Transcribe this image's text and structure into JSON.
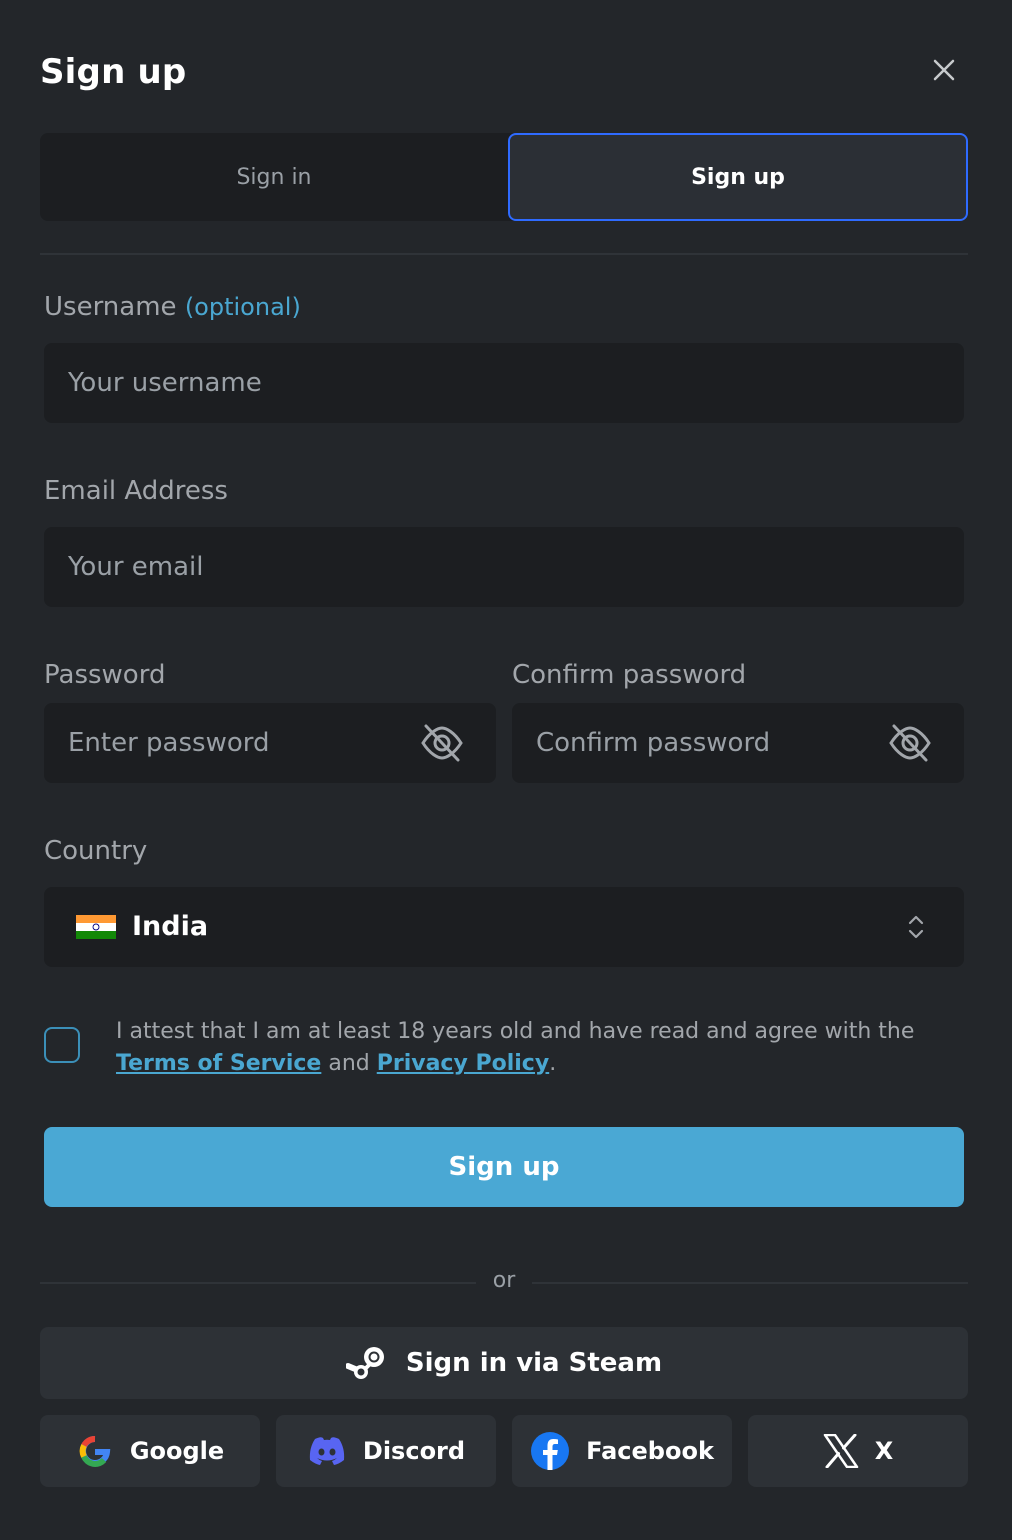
{
  "header": {
    "title": "Sign up"
  },
  "tabs": [
    {
      "label": "Sign in"
    },
    {
      "label": "Sign up"
    }
  ],
  "form": {
    "username": {
      "label": "Username",
      "optional": "(optional)",
      "placeholder": "Your username"
    },
    "email": {
      "label": "Email Address",
      "placeholder": "Your email"
    },
    "password": {
      "label": "Password",
      "placeholder": "Enter password"
    },
    "confirm": {
      "label": "Confirm password",
      "placeholder": "Confirm password"
    },
    "country": {
      "label": "Country",
      "value": "India"
    },
    "consent": {
      "text_before": "I attest that I am at least 18 years old and have read and agree with the ",
      "terms": "Terms of Service",
      "and": " and ",
      "privacy": "Privacy Policy",
      "end": "."
    },
    "submit": "Sign up"
  },
  "divider_text": "or",
  "steam_button": "Sign in via Steam",
  "social": [
    {
      "label": "Google",
      "icon": "google-icon"
    },
    {
      "label": "Discord",
      "icon": "discord-icon"
    },
    {
      "label": "Facebook",
      "icon": "facebook-icon"
    },
    {
      "label": "X",
      "icon": "x-icon"
    }
  ],
  "colors": {
    "accent": "#4aa8d4",
    "tab_border": "#2f6bff",
    "background": "#23262a",
    "input_bg": "#1c1e21"
  }
}
